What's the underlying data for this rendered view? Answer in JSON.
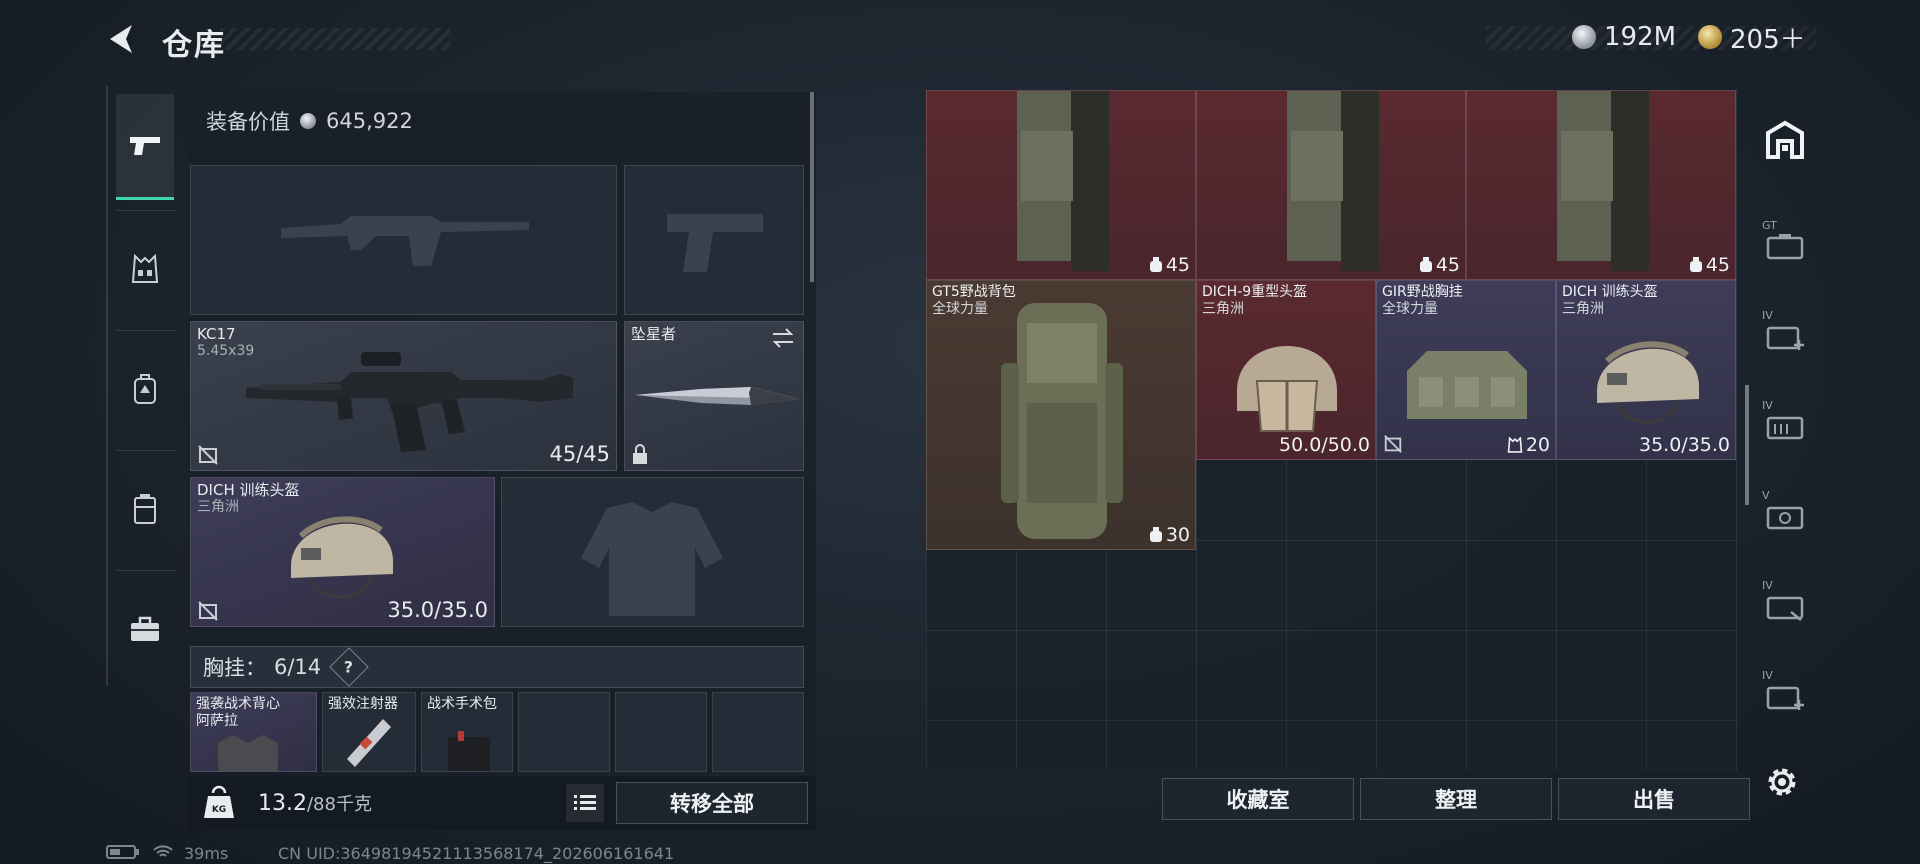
{
  "header": {
    "title": "仓库",
    "currency_silver": "192M",
    "currency_gold": "205＋"
  },
  "left_panel": {
    "equip_value_label": "装备价值",
    "equip_value": "645,922",
    "primary_weapon": {
      "name": "KC17",
      "caliber": "5.45x39",
      "ammo": "45/45"
    },
    "melee": {
      "name": "坠星者"
    },
    "helmet": {
      "name": "DICH 训练头盔",
      "brand": "三角洲",
      "durability": "35.0/35.0"
    },
    "vest_bar": {
      "label": "胸挂：",
      "count": "6/14",
      "help": "?"
    },
    "vest_items": [
      {
        "name": "强袭战术背心",
        "sub": "阿萨拉"
      },
      {
        "name": "强效注射器",
        "sub": ""
      },
      {
        "name": "战术手术包",
        "sub": ""
      }
    ],
    "weight_value": "13.2",
    "weight_max": "/88千克",
    "transfer_all": "转移全部"
  },
  "storage": {
    "items": [
      {
        "id": "leg1",
        "count": "45"
      },
      {
        "id": "leg2",
        "count": "45"
      },
      {
        "id": "leg3",
        "count": "45"
      },
      {
        "id": "backpack",
        "name": "GT5野战背包",
        "brand": "全球力量",
        "count": "30"
      },
      {
        "id": "helmet_heavy",
        "name": "DICH-9重型头盔",
        "brand": "三角洲",
        "value": "50.0/50.0"
      },
      {
        "id": "chest_rig",
        "name": "GIR野战胸挂",
        "brand": "全球力量",
        "count": "20"
      },
      {
        "id": "helmet_train",
        "name": "DICH 训练头盔",
        "brand": "三角洲",
        "value": "35.0/35.0"
      }
    ],
    "buttons": {
      "collection": "收藏室",
      "organize": "整理",
      "sell": "出售"
    }
  },
  "right_bar": [
    {
      "level": "GT",
      "icon": "storage-case-icon"
    },
    {
      "level": "IV",
      "icon": "add-case-icon"
    },
    {
      "level": "IV",
      "icon": "ammo-case-icon"
    },
    {
      "level": "V",
      "icon": "med-case-icon"
    },
    {
      "level": "IV",
      "icon": "gear-case-icon"
    },
    {
      "level": "IV",
      "icon": "add-case-icon"
    }
  ],
  "status": {
    "ping": "39ms",
    "uid": "CN UID:364981945211135681​74_202606161641"
  },
  "colors": {
    "accent": "#3fd5b0",
    "red_rarity": "#5a2a30",
    "purple_rarity": "#3e3c58",
    "brown_rarity": "#4a3a32"
  }
}
